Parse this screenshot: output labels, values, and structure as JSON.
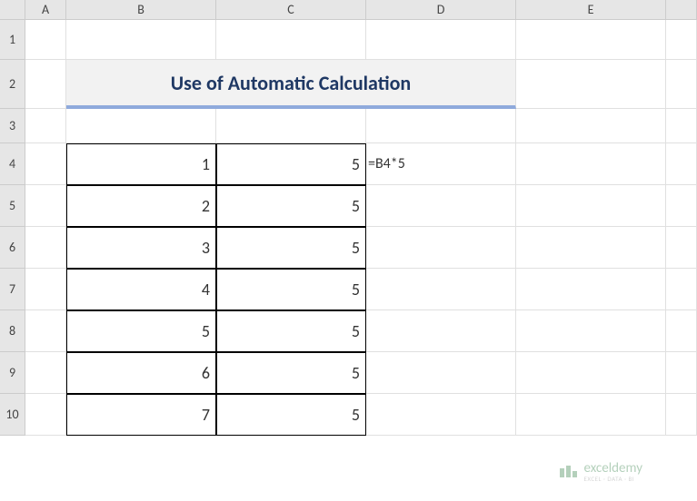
{
  "columns": {
    "A": "A",
    "B": "B",
    "C": "C",
    "D": "D",
    "E": "E",
    "F": ""
  },
  "rows": [
    "1",
    "2",
    "3",
    "4",
    "5",
    "6",
    "7",
    "8",
    "9",
    "10"
  ],
  "title": "Use of Automatic Calculation",
  "formula_label": "=B4*5",
  "chart_data": {
    "type": "table",
    "columns": [
      "B",
      "C"
    ],
    "rows": [
      {
        "B": 1,
        "C": 5
      },
      {
        "B": 2,
        "C": 5
      },
      {
        "B": 3,
        "C": 5
      },
      {
        "B": 4,
        "C": 5
      },
      {
        "B": 5,
        "C": 5
      },
      {
        "B": 6,
        "C": 5
      },
      {
        "B": 7,
        "C": 5
      }
    ]
  },
  "watermark": {
    "main": "exceldemy",
    "sub": "EXCEL · DATA · BI"
  }
}
